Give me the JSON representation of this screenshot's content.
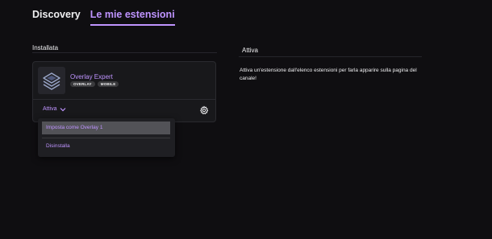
{
  "tabs": [
    {
      "label": "Discovery",
      "active": false
    },
    {
      "label": "Le mie estensioni",
      "active": true
    }
  ],
  "installed": {
    "heading": "Installata",
    "extension": {
      "name": "Overlay Expert",
      "icon": "overlay-expert-layers-icon",
      "badges": [
        "OVERLAY",
        "MOBILE"
      ],
      "status": "Attiva"
    },
    "menu": {
      "items": [
        "Imposta come Overlay 1",
        "Disinstalla"
      ],
      "highlighted": "Imposta come Overlay 1"
    }
  },
  "active_panel": {
    "heading": "Attiva",
    "description": "Attiva un'estensione dall'elenco estensioni per farla apparire sulla pagina del canale!"
  },
  "colors": {
    "background": "#0f0e11",
    "card": "#18181b",
    "accent": "#bf94ff",
    "menu": "#1f1f23",
    "menu_highlight": "#525257",
    "badge": "#3a3a3d"
  }
}
